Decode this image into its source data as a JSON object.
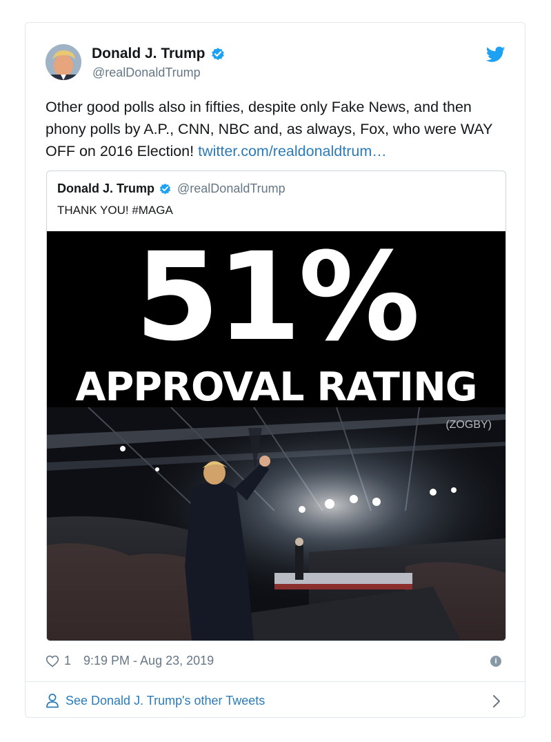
{
  "author": {
    "name": "Donald J. Trump",
    "handle": "@realDonaldTrump"
  },
  "tweet": {
    "text": "Other good polls also in fifties, despite only Fake News, and then phony polls by A.P., CNN, NBC and, as always, Fox, who were WAY OFF on 2016 Election! ",
    "link_text": "twitter.com/realdonaldtrum…"
  },
  "quoted_tweet": {
    "name": "Donald J. Trump",
    "handle": "@realDonaldTrump",
    "text": "THANK YOU! #MAGA",
    "media": {
      "headline_number": "51%",
      "headline_text": "APPROVAL RATING",
      "source": "(ZOGBY)"
    }
  },
  "meta": {
    "like_count": "1",
    "timestamp": "9:19 PM - Aug 23, 2019",
    "info_glyph": "i"
  },
  "footer": {
    "see_more": "See Donald J. Trump's other Tweets"
  },
  "icons": {
    "avatar": "avatar-photo",
    "verified": "verified-badge-icon",
    "brand": "twitter-bird-icon",
    "like": "heart-icon",
    "info": "info-icon",
    "profile": "person-icon",
    "forward": "chevron-right-icon"
  },
  "colors": {
    "accent": "#1da1f2",
    "link": "#2b7bb9",
    "secondary_text": "#657786",
    "border": "#e1e8ed"
  }
}
